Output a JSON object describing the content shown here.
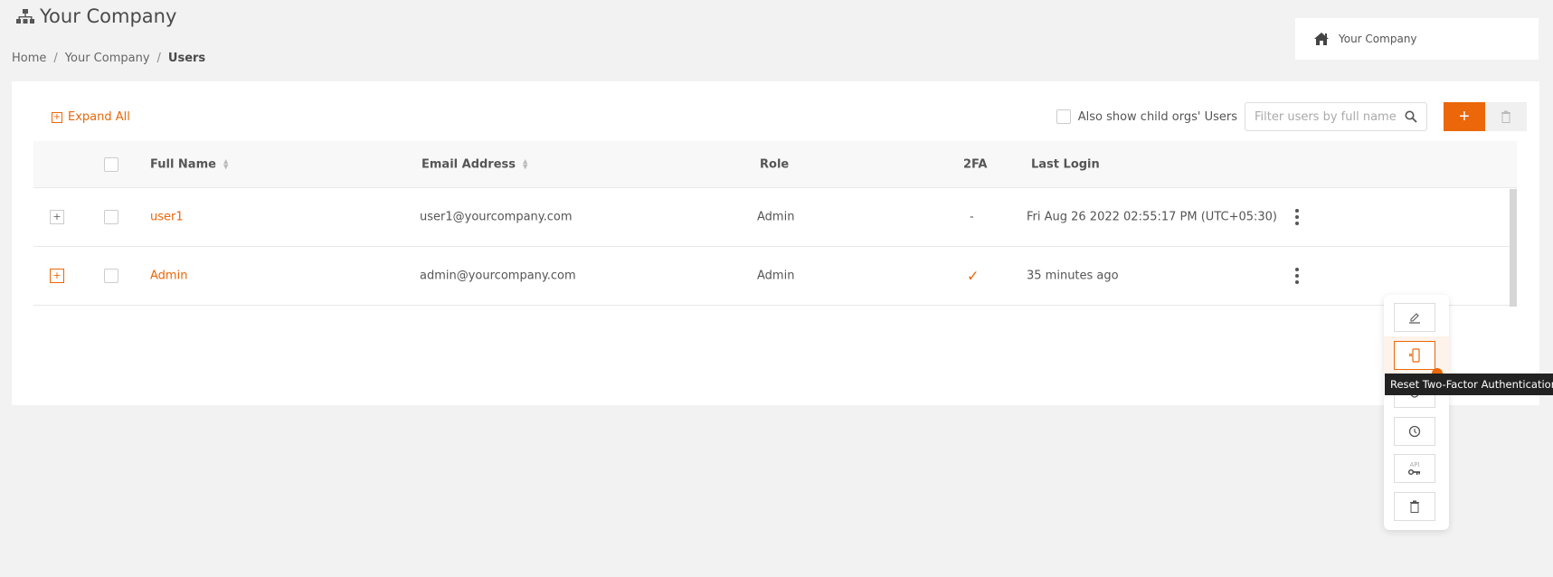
{
  "header": {
    "title": "Your Company",
    "title_icon": "sitemap-icon",
    "breadcrumb": [
      "Home",
      "Your Company",
      "Users"
    ]
  },
  "org_card": {
    "icon": "home-icon",
    "label": "Your Company"
  },
  "toolbar": {
    "expand_all_label": "Expand All",
    "child_orgs_label": "Also show child orgs' Users",
    "child_orgs_checked": false,
    "search_placeholder": "Filter users by full name",
    "search_value": "",
    "add_label": "+",
    "delete_icon": "trash-icon"
  },
  "table": {
    "columns": [
      "Full Name",
      "Email Address",
      "Role",
      "2FA",
      "Last Login"
    ],
    "rows": [
      {
        "name": "user1",
        "email": "user1@yourcompany.com",
        "role": "Admin",
        "twofa": "-",
        "last_login": "Fri Aug 26 2022 02:55:17 PM (UTC+05:30)"
      },
      {
        "name": "Admin",
        "email": "admin@yourcompany.com",
        "role": "Admin",
        "twofa": "✓",
        "last_login": "35 minutes ago"
      }
    ]
  },
  "action_menu": {
    "items": [
      {
        "icon": "edit-icon",
        "label": "Edit"
      },
      {
        "icon": "reset-2fa-icon",
        "label": "Reset Two-Factor Authentication",
        "active": true
      },
      {
        "icon": "reset-password-icon",
        "label": "Reset"
      },
      {
        "icon": "clock-icon",
        "label": "History"
      },
      {
        "icon": "api-key-icon",
        "label": "API",
        "sublabel": "API"
      },
      {
        "icon": "trash-icon",
        "label": "Delete"
      }
    ],
    "tooltip": "Reset Two-Factor Authentication"
  },
  "colors": {
    "accent": "#eb6709",
    "background": "#f2f2f2",
    "panel": "#ffffff"
  }
}
